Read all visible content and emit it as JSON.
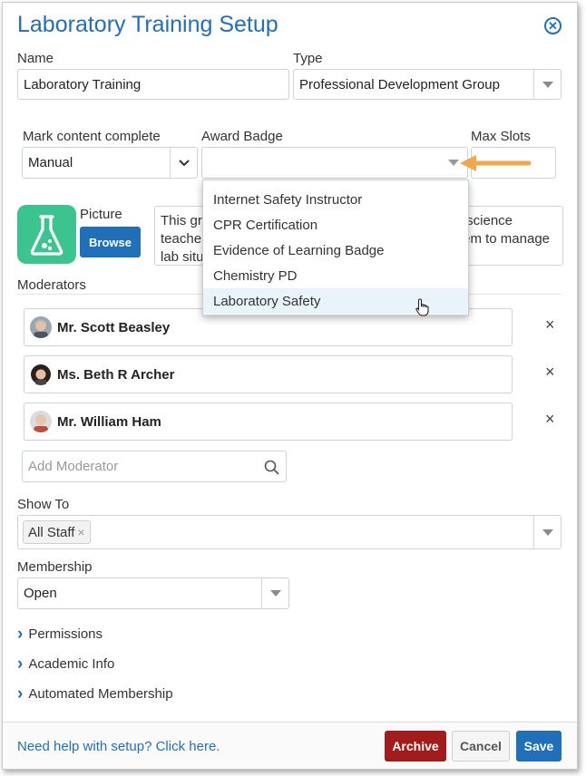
{
  "dialog": {
    "title": "Laboratory Training Setup"
  },
  "name": {
    "label": "Name",
    "value": "Laboratory Training"
  },
  "type": {
    "label": "Type",
    "value": "Professional Development Group"
  },
  "mark_complete": {
    "label": "Mark content complete",
    "value": "Manual"
  },
  "award_badge": {
    "label": "Award Badge",
    "value": "",
    "options": [
      "Internet Safety Instructor",
      "CPR Certification",
      "Evidence of Learning Badge",
      "Chemistry PD",
      "Laboratory Safety"
    ],
    "highlighted": "Laboratory Safety"
  },
  "max_slots": {
    "label": "Max Slots",
    "value": ""
  },
  "picture": {
    "label": "Picture",
    "browse_label": "Browse",
    "icon": "flask-icon"
  },
  "description": {
    "line1_start": "This gro",
    "line1_end": "science",
    "line2_start": "teacher",
    "line2_end": "em to manage",
    "line3_start": "lab situ"
  },
  "moderators": {
    "label": "Moderators",
    "items": [
      {
        "name": "Mr. Scott Beasley"
      },
      {
        "name": "Ms. Beth R Archer"
      },
      {
        "name": "Mr. William Ham"
      }
    ],
    "add_placeholder": "Add Moderator",
    "remove_glyph": "×"
  },
  "show_to": {
    "label": "Show To",
    "tags": [
      "All Staff"
    ],
    "tag_remove_glyph": "×"
  },
  "membership": {
    "label": "Membership",
    "value": "Open"
  },
  "sections": [
    "Permissions",
    "Academic Info",
    "Automated Membership"
  ],
  "footer": {
    "help_link": "Need help with setup? Click here.",
    "archive_label": "Archive",
    "cancel_label": "Cancel",
    "save_label": "Save"
  },
  "colors": {
    "accent": "#1f6fb9",
    "archive": "#a31c1c",
    "flask_bg": "#3cc48f",
    "arrow": "#f3a64a"
  }
}
